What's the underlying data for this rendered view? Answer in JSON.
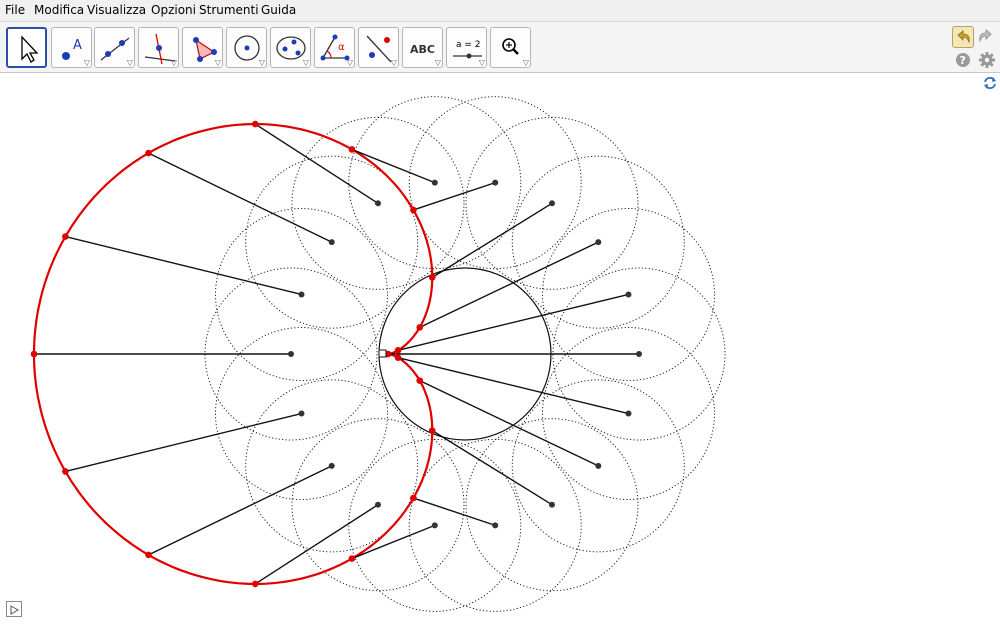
{
  "menu": [
    "File",
    "Modifica",
    "Visualizza",
    "Opzioni",
    "Strumenti",
    "Guida"
  ],
  "toolbar": {
    "text_tool_label": "ABC",
    "slider_tool_label": "a = 2",
    "point_tool_label": "A",
    "angle_tool_label": "α"
  },
  "icons": {
    "undo": "undo-icon",
    "redo": "redo-icon",
    "help": "help-icon",
    "settings": "gear-icon",
    "refresh": "refresh-icon",
    "play": "play-icon"
  },
  "colors": {
    "curve": "#e00000",
    "points": "#e00000",
    "centers": "#333333",
    "selected_tool": "#2b4ea8"
  },
  "construction": {
    "circle_count": 18,
    "locus": "cardioid"
  }
}
